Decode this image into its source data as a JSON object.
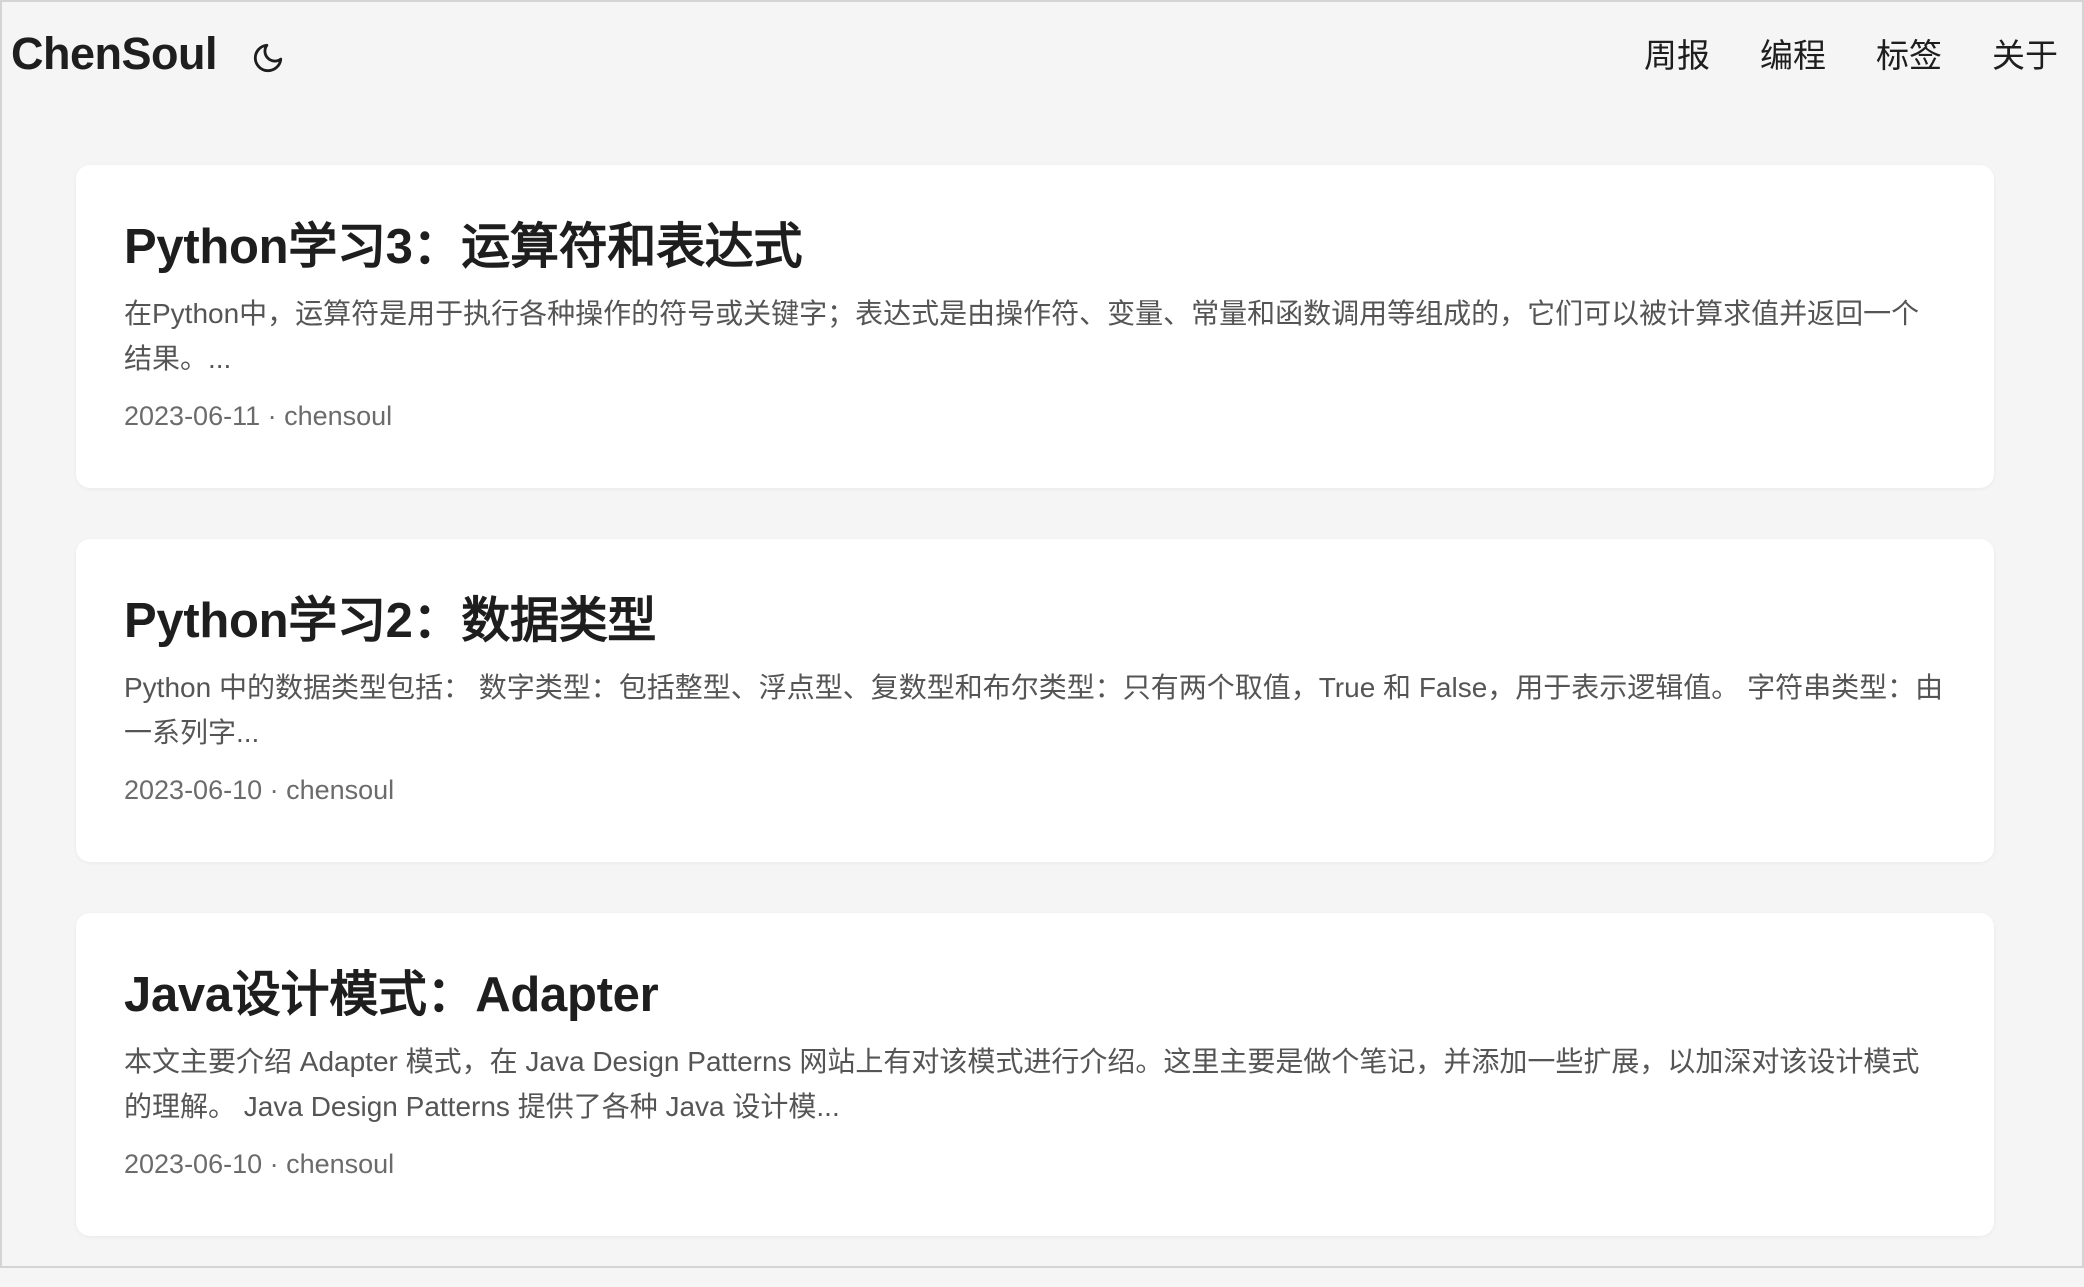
{
  "header": {
    "logo": "ChenSoul",
    "theme_toggle_icon": "moon-icon",
    "nav": [
      {
        "label": "周报"
      },
      {
        "label": "编程"
      },
      {
        "label": "标签"
      },
      {
        "label": "关于"
      }
    ]
  },
  "posts": [
    {
      "title": "Python学习3：运算符和表达式",
      "excerpt": "在Python中，运算符是用于执行各种操作的符号或关键字；表达式是由操作符、变量、常量和函数调用等组成的，它们可以被计算求值并返回一个结果。...",
      "date": "2023-06-11",
      "author": "chensoul",
      "meta": "2023-06-11 · chensoul"
    },
    {
      "title": "Python学习2：数据类型",
      "excerpt": "Python 中的数据类型包括： 数字类型：包括整型、浮点型、复数型和布尔类型：只有两个取值，True 和 False，用于表示逻辑值。 字符串类型：由一系列字...",
      "date": "2023-06-10",
      "author": "chensoul",
      "meta": "2023-06-10 · chensoul"
    },
    {
      "title": "Java设计模式：Adapter",
      "excerpt": "本文主要介绍 Adapter 模式，在 Java Design Patterns 网站上有对该模式进行介绍。这里主要是做个笔记，并添加一些扩展，以加深对该设计模式的理解。 Java Design Patterns 提供了各种 Java 设计模...",
      "date": "2023-06-10",
      "author": "chensoul",
      "meta": "2023-06-10 · chensoul"
    }
  ]
}
